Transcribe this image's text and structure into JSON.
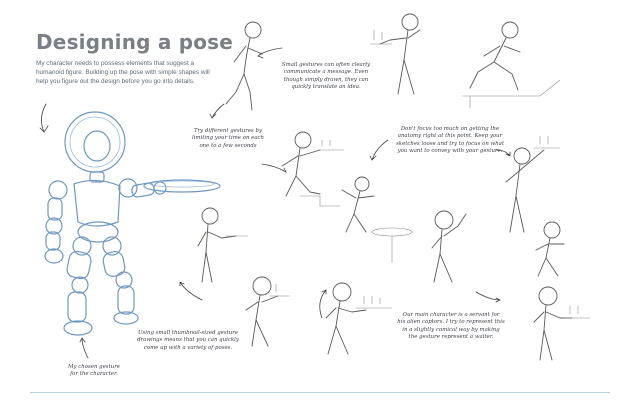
{
  "title": "Designing a pose",
  "intro": "My character needs to possess elements that suggest a humanoid figure. Building up the pose with simple shapes will help you figure out the design before you go into details.",
  "notes": {
    "small_gestures": "Small gestures can often clearly\ncommunicate a message. Even\nthough simply drawn, they can\nquickly translate an idea.",
    "try_gestures": "Try different gestures by\nlimiting your time on each\none to a few seconds",
    "anatomy": "Don't focus too much on getting the\nanatomy right at this point. Keep your\nsketches loose and try to focus on what\nyou want to convey with your gesture.",
    "thumbnails": "Using small thumbnail-sized gesture\ndrawings means that you can quickly\ncome up with a variety of poses.",
    "main_character": "Our main character is a servant for\nhis alien captors. I try to represent this\nin a slightly comical way by making\nthe gesture represent a waiter.",
    "chosen": "My chosen gesture\nfor the character."
  },
  "colors": {
    "title": "#7a7f86",
    "intro_text": "#5f6b7a",
    "pencil": "#55595f",
    "blue_construction": "#6f97c2",
    "rule": "#b9cfdc"
  }
}
